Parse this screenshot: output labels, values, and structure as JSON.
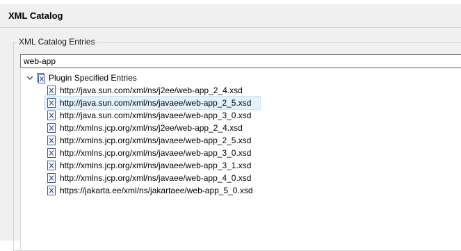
{
  "window": {
    "title": "XML Catalog"
  },
  "group": {
    "label": "XML Catalog Entries"
  },
  "filter": {
    "value": "web-app"
  },
  "tree": {
    "root_label": "Plugin Specified Entries",
    "expanded": true,
    "selected_index": 1,
    "entries": [
      "http://java.sun.com/xml/ns/j2ee/web-app_2_4.xsd",
      "http://java.sun.com/xml/ns/javaee/web-app_2_5.xsd",
      "http://java.sun.com/xml/ns/javaee/web-app_3_0.xsd",
      "http://xmlns.jcp.org/xml/ns/j2ee/web-app_2_4.xsd",
      "http://xmlns.jcp.org/xml/ns/javaee/web-app_2_5.xsd",
      "http://xmlns.jcp.org/xml/ns/javaee/web-app_3_0.xsd",
      "http://xmlns.jcp.org/xml/ns/javaee/web-app_3_1.xsd",
      "http://xmlns.jcp.org/xml/ns/javaee/web-app_4_0.xsd",
      "https://jakarta.ee/xml/ns/jakartaee/web-app_5_0.xsd"
    ]
  },
  "icons": {
    "chevron": "chevron-down-icon",
    "root": "xml-catalog-icon",
    "entry": "xsd-file-icon"
  },
  "colors": {
    "selection_bg": "#e5f1fb",
    "selection_border": "#cce4f7",
    "panel_bg": "#f0f0f0"
  }
}
